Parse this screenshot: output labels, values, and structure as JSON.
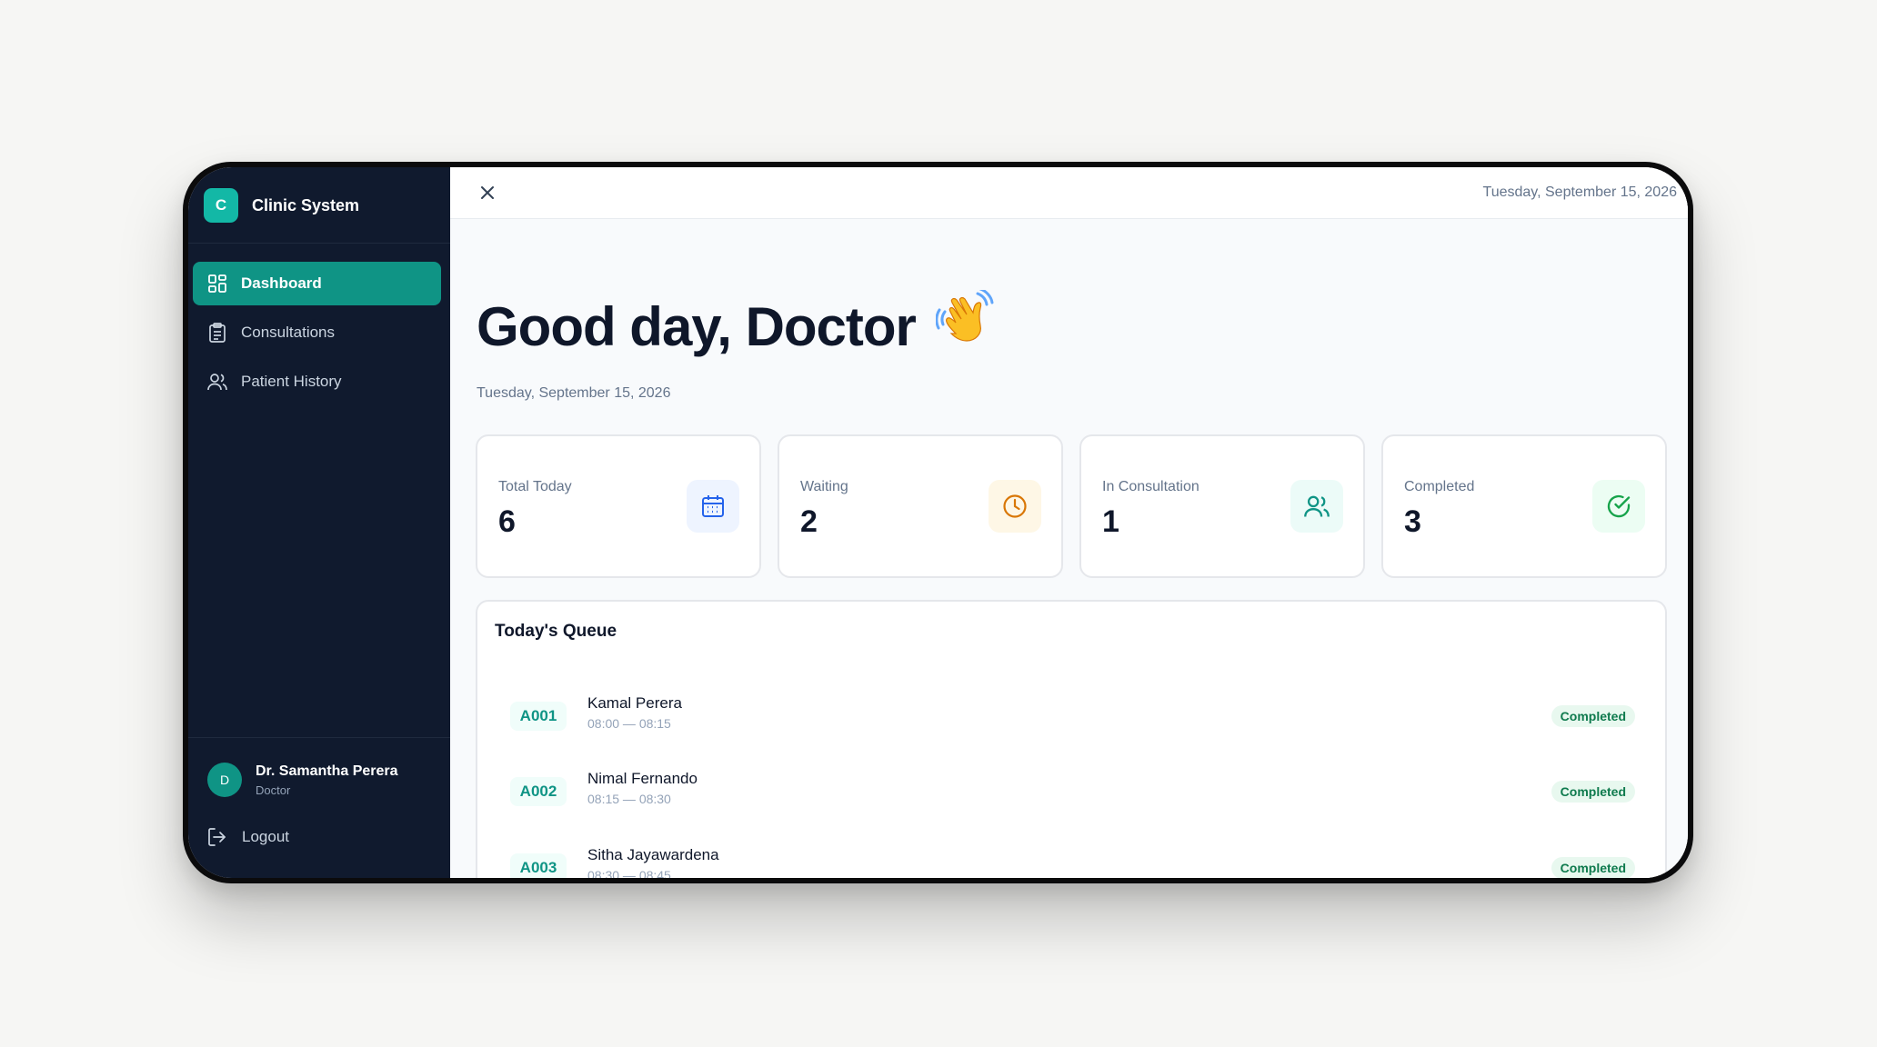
{
  "app": {
    "logo_letter": "C",
    "name": "Clinic System"
  },
  "sidebar": {
    "items": [
      {
        "label": "Dashboard",
        "icon": "dashboard-grid-icon",
        "active": true
      },
      {
        "label": "Consultations",
        "icon": "clipboard-icon",
        "active": false
      },
      {
        "label": "Patient History",
        "icon": "users-icon",
        "active": false
      }
    ],
    "user": {
      "avatar_letter": "D",
      "name": "Dr. Samantha Perera",
      "role": "Doctor"
    },
    "logout_label": "Logout"
  },
  "topbar": {
    "date": "Tuesday, September 15, 2026"
  },
  "main": {
    "greeting": "Good day, Doctor",
    "greeting_emoji": "👋",
    "date": "Tuesday, September 15, 2026"
  },
  "stats": [
    {
      "label": "Total Today",
      "value": "6",
      "icon": "calendar-icon",
      "icon_color": "#2563eb",
      "icon_bg": "#eef4ff"
    },
    {
      "label": "Waiting",
      "value": "2",
      "icon": "clock-icon",
      "icon_color": "#d97706",
      "icon_bg": "#fef7e6"
    },
    {
      "label": "In Consultation",
      "value": "1",
      "icon": "users-icon",
      "icon_color": "#0f9485",
      "icon_bg": "#ecfbf8"
    },
    {
      "label": "Completed",
      "value": "3",
      "icon": "check-circle-icon",
      "icon_color": "#16a34a",
      "icon_bg": "#ecfdf3"
    }
  ],
  "queue": {
    "title": "Today's Queue",
    "rows": [
      {
        "token": "A001",
        "name": "Kamal Perera",
        "time": "08:00 — 08:15",
        "status": "Completed"
      },
      {
        "token": "A002",
        "name": "Nimal Fernando",
        "time": "08:15 — 08:30",
        "status": "Completed"
      },
      {
        "token": "A003",
        "name": "Sitha Jayawardena",
        "time": "08:30 — 08:45",
        "status": "Completed"
      }
    ]
  },
  "colors": {
    "sidebar_bg": "#101a2e",
    "accent": "#0f9485",
    "brand_teal": "#13b8a6"
  }
}
